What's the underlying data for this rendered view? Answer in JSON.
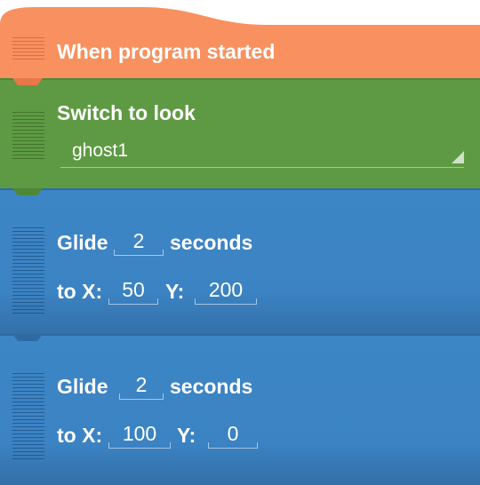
{
  "blocks": {
    "hat": {
      "label": "When program started",
      "color": "#f8915f"
    },
    "switch_look": {
      "label": "Switch to look",
      "selected": "ghost1",
      "color": "#5e9a43"
    },
    "glide_1": {
      "glide": "Glide",
      "seconds_value": "2",
      "seconds": "seconds",
      "to_x": "to X:",
      "x_value": "50",
      "y": "Y:",
      "y_value": "200",
      "color": "#3b83c3"
    },
    "glide_2": {
      "glide": "Glide",
      "seconds_value": "2",
      "seconds": "seconds",
      "to_x": "to X:",
      "x_value": "100",
      "y": "Y:",
      "y_value": "0",
      "color": "#3b83c3"
    }
  },
  "icons": {
    "drag_handle": "grip-lines-icon",
    "dropdown": "dropdown-caret-icon"
  }
}
